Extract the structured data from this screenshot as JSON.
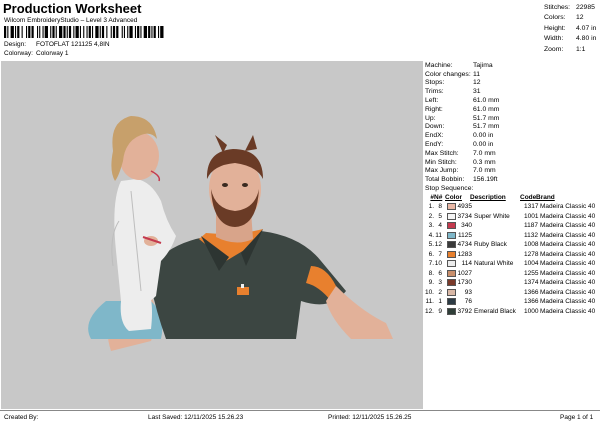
{
  "header": {
    "title": "Production Worksheet",
    "subtitle": "Wilcom EmbroideryStudio – Level 3 Advanced",
    "design_label": "Design:",
    "design_value": "FOTOFLAT 121125 4,8IN",
    "colorway_label": "Colorway:",
    "colorway_value": "Colorway 1"
  },
  "stats": {
    "stitches_label": "Stitches:",
    "stitches": "22985",
    "colors_label": "Colors:",
    "colors": "12",
    "height_label": "Height:",
    "height": "4.07 in",
    "width_label": "Width:",
    "width": "4.80 in",
    "zoom_label": "Zoom:",
    "zoom": "1:1"
  },
  "machine": [
    {
      "k": "Machine:",
      "v": "Tajima"
    },
    {
      "k": "Color changes:",
      "v": "11"
    },
    {
      "k": "Stops:",
      "v": "12"
    },
    {
      "k": "Trims:",
      "v": "31"
    },
    {
      "k": "Left:",
      "v": "61.0 mm"
    },
    {
      "k": "Right:",
      "v": "61.0 mm"
    },
    {
      "k": "Up:",
      "v": "51.7 mm"
    },
    {
      "k": "Down:",
      "v": "51.7 mm"
    },
    {
      "k": "EndX:",
      "v": "0.00 in"
    },
    {
      "k": "EndY:",
      "v": "0.00 in"
    },
    {
      "k": "Max Stitch:",
      "v": "7.0 mm"
    },
    {
      "k": "Min Stitch:",
      "v": "0.3 mm"
    },
    {
      "k": "Max Jump:",
      "v": "7.0 mm"
    },
    {
      "k": "Total Bobbin:",
      "v": "156.19ft"
    }
  ],
  "stop_sequence": {
    "title": "Stop Sequence:",
    "headers": {
      "stop": "#",
      "n": "N#",
      "color": "Color",
      "desc": "Description",
      "code": "Code",
      "brand": "Brand"
    },
    "rows": [
      {
        "stop": "1.",
        "n": "8",
        "swatch": "#e9b8a6",
        "code": "4935",
        "desc": "",
        "thread": "1317",
        "brand": "Madeira Classic 40"
      },
      {
        "stop": "2.",
        "n": "5",
        "swatch": "#f4f4f4",
        "code": "3734",
        "desc": "Super White",
        "thread": "1001",
        "brand": "Madeira Classic 40"
      },
      {
        "stop": "3.",
        "n": "4",
        "swatch": "#c43a4e",
        "code": "340",
        "desc": "",
        "thread": "1187",
        "brand": "Madeira Classic 40"
      },
      {
        "stop": "4.",
        "n": "11",
        "swatch": "#7fb7c9",
        "code": "1125",
        "desc": "",
        "thread": "1132",
        "brand": "Madeira Classic 40"
      },
      {
        "stop": "5.",
        "n": "12",
        "swatch": "#3a3a3a",
        "code": "4734",
        "desc": "Ruby Black",
        "thread": "1008",
        "brand": "Madeira Classic 40"
      },
      {
        "stop": "6.",
        "n": "7",
        "swatch": "#e8802e",
        "code": "1283",
        "desc": "",
        "thread": "1278",
        "brand": "Madeira Classic 40"
      },
      {
        "stop": "7.",
        "n": "10",
        "swatch": "#ececec",
        "code": "114",
        "desc": "Natural White",
        "thread": "1004",
        "brand": "Madeira Classic 40"
      },
      {
        "stop": "8.",
        "n": "6",
        "swatch": "#c98f6c",
        "code": "1027",
        "desc": "",
        "thread": "1255",
        "brand": "Madeira Classic 40"
      },
      {
        "stop": "9.",
        "n": "3",
        "swatch": "#7a3a2a",
        "code": "1730",
        "desc": "",
        "thread": "1374",
        "brand": "Madeira Classic 40"
      },
      {
        "stop": "10.",
        "n": "2",
        "swatch": "#d9b8a6",
        "code": "93",
        "desc": "",
        "thread": "1366",
        "brand": "Madeira Classic 40"
      },
      {
        "stop": "11.",
        "n": "1",
        "swatch": "#2c3a44",
        "code": "76",
        "desc": "",
        "thread": "1366",
        "brand": "Madeira Classic 40"
      },
      {
        "stop": "12.",
        "n": "9",
        "swatch": "#2f3e38",
        "code": "3792",
        "desc": "Emerald Black",
        "thread": "1000",
        "brand": "Madeira Classic 40"
      }
    ]
  },
  "footer": {
    "created_by": "Created By:",
    "last_saved": "Last Saved: 12/11/2025 15.26.23",
    "printed": "Printed: 12/11/2025 15.26.25",
    "page": "Page 1 of 1"
  },
  "colors": {
    "design_bg": "#c8c8c8",
    "shirt": "#3c4642",
    "shirt_accent": "#e8802e",
    "skin": "#e2b199",
    "hair_child": "#c7a06b",
    "hair_man": "#6a3b26",
    "pajama": "#ededed"
  }
}
